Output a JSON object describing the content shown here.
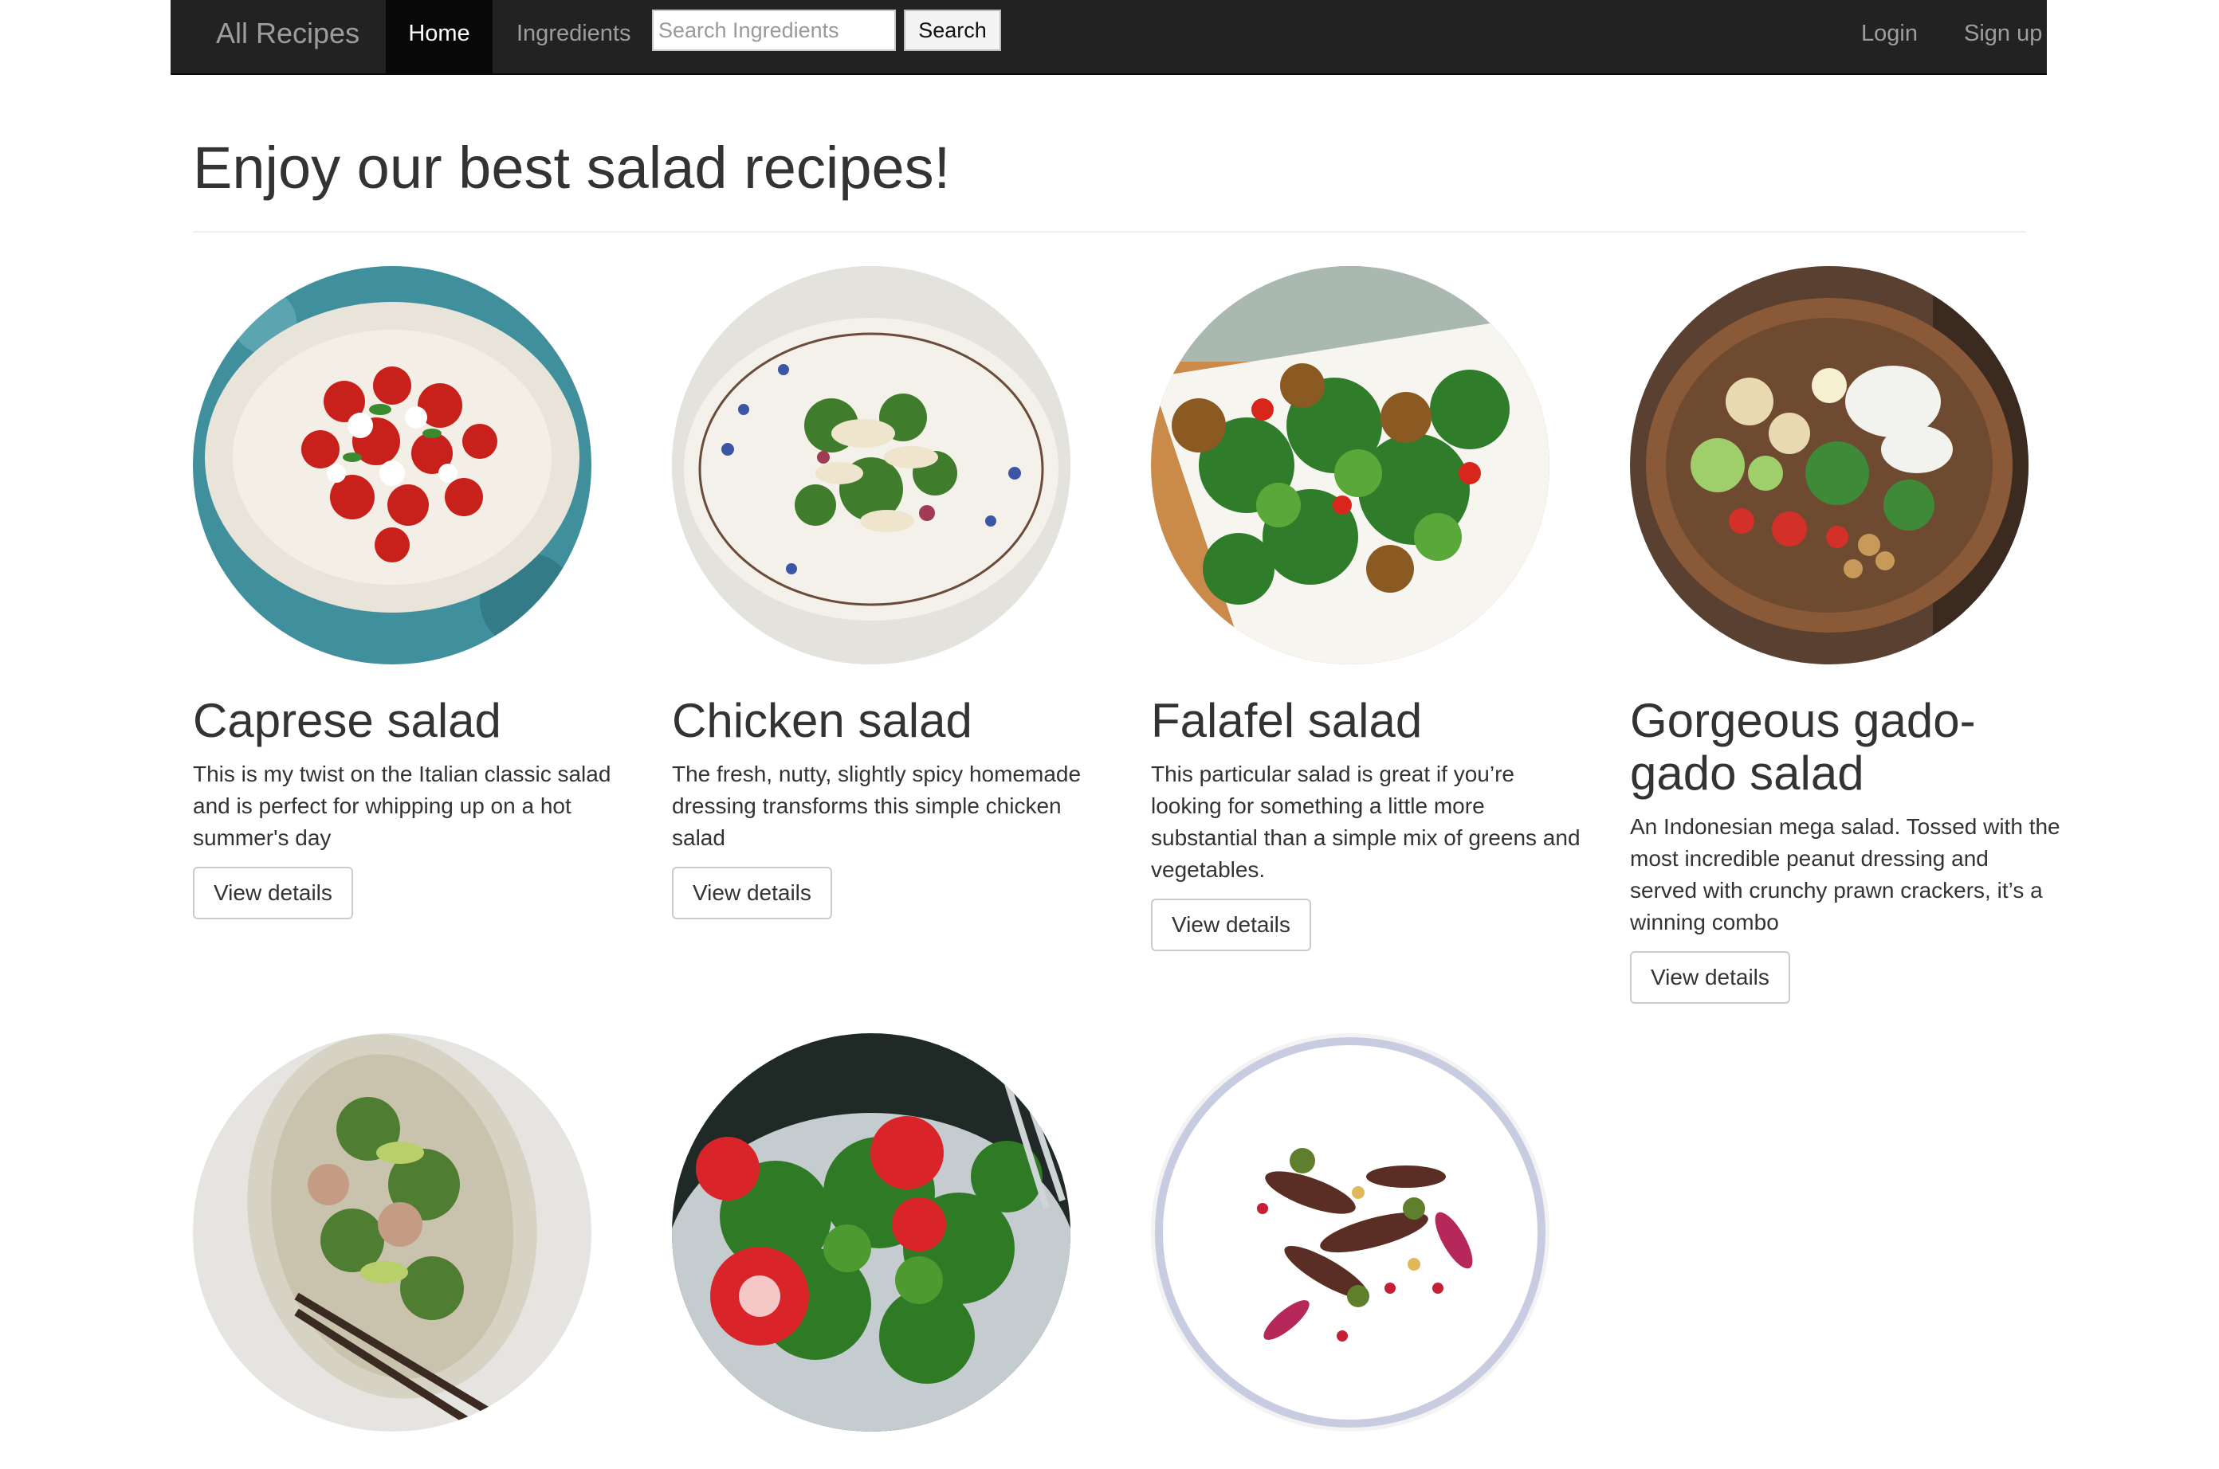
{
  "navbar": {
    "brand": "All Recipes",
    "home": "Home",
    "ingredients": "Ingredients",
    "search_placeholder": "Search Ingredients",
    "search_button": "Search",
    "login": "Login",
    "signup": "Sign up"
  },
  "page": {
    "title": "Enjoy our best salad recipes!"
  },
  "recipes": [
    {
      "title": "Caprese salad",
      "description": "This is my twist on the Italian classic salad and is perfect for whipping up on a hot summer's day",
      "button": "View details"
    },
    {
      "title": "Chicken salad",
      "description": "The fresh, nutty, slightly spicy homemade dressing transforms this simple chicken salad",
      "button": "View details"
    },
    {
      "title": "Falafel salad",
      "description": "This particular salad is great if you’re looking for something a little more substantial than a simple mix of greens and vegetables.",
      "button": "View details"
    },
    {
      "title": "Gorgeous gado-gado salad",
      "description": "An Indonesian mega salad. Tossed with the most incredible peanut dressing and served with crunchy prawn crackers, it’s a winning combo",
      "button": "View details"
    }
  ],
  "colors": {
    "navbar_bg": "#222222",
    "navbar_active": "#080808",
    "navbar_text": "#9d9d9d",
    "body_text": "#333333"
  }
}
